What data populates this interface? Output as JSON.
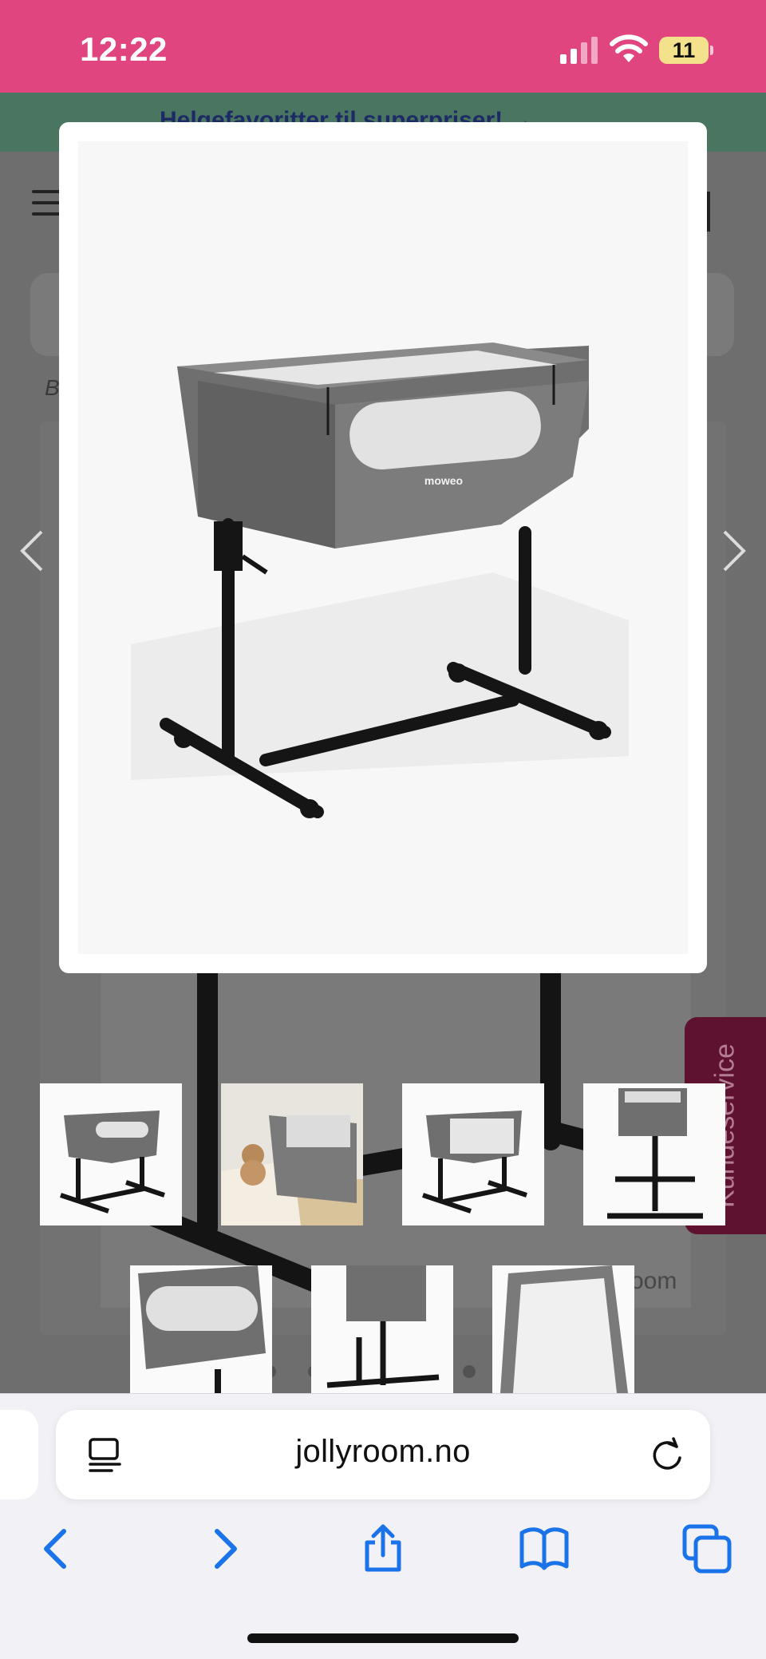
{
  "status_bar": {
    "time": "12:22",
    "battery_level": "11",
    "background": "#e0457f"
  },
  "page_background": {
    "banner_text": "Helgefavoritter til superpriser! →",
    "breadcrumb_initial": "B",
    "caption_fragment": "oom",
    "side_tab_label": "Kundeservice"
  },
  "modal": {
    "product_brand_label": "moweo"
  },
  "thumbnails": [
    {
      "view": "front-angle"
    },
    {
      "view": "bedroom-with-teddy"
    },
    {
      "view": "side-panel-open"
    },
    {
      "view": "raised-side"
    },
    {
      "view": "closeup-window"
    },
    {
      "view": "legs-closeup"
    },
    {
      "view": "interior-mattress"
    }
  ],
  "browser": {
    "url": "jollyroom.no",
    "icons": [
      "reader-mode-icon",
      "reload-icon",
      "back-icon",
      "forward-icon",
      "share-icon",
      "bookmarks-icon",
      "tabs-icon"
    ]
  },
  "colors": {
    "accent_blue": "#1a73e8",
    "status_pink": "#e0457f",
    "overlay_grey": "#6e6e6e"
  }
}
